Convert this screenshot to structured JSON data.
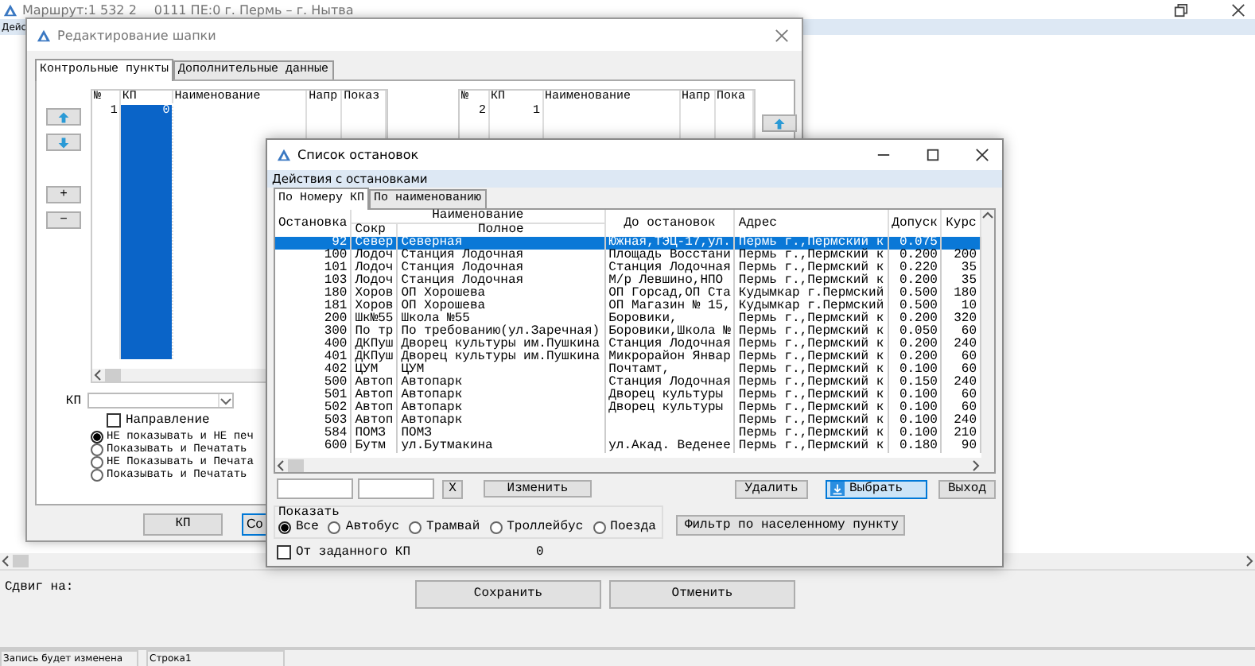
{
  "main_window": {
    "title_route": "Маршрут:1 532 2",
    "title_info": "0111 ПЕ:0 г. Пермь – г. Нытва",
    "menu_item": "Дейс",
    "shift_label": "Сдвиг на:",
    "buttons": [
      "Сохранить",
      "Отменить"
    ],
    "status_bar": [
      "Запись будет изменена",
      "Строка1"
    ]
  },
  "editor": {
    "title": "Редактирование шапки",
    "tabs": [
      {
        "label": "Контрольные пункты",
        "selected": true
      },
      {
        "label": "Дополнительные данные",
        "selected": false
      }
    ],
    "left_grid": {
      "columns": [
        "№",
        "КП",
        "Наименование",
        "Напр",
        "Показ"
      ],
      "rows": [
        {
          "cells": [
            "1",
            "0"
          ],
          "selected": true
        }
      ]
    },
    "right_grid": {
      "columns": [
        "№",
        "КП",
        "Наименование",
        "Напр",
        "Пока"
      ],
      "rows": [
        {
          "cells": [
            "2",
            "1"
          ],
          "selected": false
        }
      ]
    },
    "side_buttons": [
      "+",
      "−"
    ],
    "kp_label": "КП",
    "direction_checkbox": {
      "label": "Направление",
      "checked": false
    },
    "print_options": [
      {
        "label": "НЕ показывать и НЕ печ",
        "selected": true
      },
      {
        "label": "Показывать и Печатать",
        "selected": false
      },
      {
        "label": "НЕ Показывать и Печата",
        "selected": false
      },
      {
        "label": "Показывать и Печатать",
        "selected": false
      }
    ],
    "buttons": [
      "КП",
      "Со"
    ]
  },
  "dialog": {
    "title": "Список остановок",
    "menu_item": "Действия с остановками",
    "tabs": [
      {
        "label": "По Номеру КП",
        "selected": true
      },
      {
        "label": "По наименованию",
        "selected": false
      }
    ],
    "grid": {
      "header_group": "Наименование",
      "columns": [
        "Остановка",
        "Сокр",
        "Полное",
        "До остановок",
        "Адрес",
        "Допуск",
        "Курс"
      ],
      "rows": [
        {
          "cells": [
            "92",
            "Север",
            "Северная",
            "Южная,ТЭЦ-17,ул.",
            "Пермь г.,Пермский к",
            "0.075",
            ""
          ],
          "selected": true
        },
        {
          "cells": [
            "100",
            "Лодоч",
            "Станция Лодочная",
            "Площадь Восстани",
            "Пермь г.,Пермский к",
            "0.200",
            "200"
          ],
          "selected": false
        },
        {
          "cells": [
            "101",
            "Лодоч",
            "Станция Лодочная",
            "Станция Лодочная",
            "Пермь г.,Пермский к",
            "0.220",
            "35"
          ],
          "selected": false
        },
        {
          "cells": [
            "103",
            "Лодоч",
            "Станция Лодочная",
            "М/р Левшино,НПО",
            "Пермь г.,Пермский к",
            "0.200",
            "35"
          ],
          "selected": false
        },
        {
          "cells": [
            "180",
            "Хоров",
            "ОП Хорошева",
            "ОП Горсад,ОП Ста",
            "Кудымкар г.Пермский",
            "0.500",
            "180"
          ],
          "selected": false
        },
        {
          "cells": [
            "181",
            "Хоров",
            "ОП Хорошева",
            "ОП Магазин № 15,",
            "Кудымкар г.Пермский",
            "0.500",
            "10"
          ],
          "selected": false
        },
        {
          "cells": [
            "200",
            "Шк№55",
            "Школа №55",
            "Боровики,",
            "Пермь г.,Пермский к",
            "0.200",
            "320"
          ],
          "selected": false
        },
        {
          "cells": [
            "300",
            "По тр",
            "По требованию(ул.Заречная)",
            "Боровики,Школа №",
            "Пермь г.,Пермский к",
            "0.050",
            "60"
          ],
          "selected": false
        },
        {
          "cells": [
            "400",
            "ДКПуш",
            "Дворец культуры им.Пушкина",
            "Станция Лодочная",
            "Пермь г.,Пермский к",
            "0.200",
            "240"
          ],
          "selected": false
        },
        {
          "cells": [
            "401",
            "ДКПуш",
            "Дворец культуры им.Пушкина",
            "Микрорайон Январ",
            "Пермь г.,Пермский к",
            "0.200",
            "60"
          ],
          "selected": false
        },
        {
          "cells": [
            "402",
            "ЦУМ",
            "ЦУМ",
            "Почтамт,",
            "Пермь г.,Пермский к",
            "0.100",
            "60"
          ],
          "selected": false
        },
        {
          "cells": [
            "500",
            "Автоп",
            "Автопарк",
            "Станция Лодочная",
            "Пермь г.,Пермский к",
            "0.150",
            "240"
          ],
          "selected": false
        },
        {
          "cells": [
            "501",
            "Автоп",
            "Автопарк",
            "Дворец культуры",
            "Пермь г.,Пермский к",
            "0.100",
            "60"
          ],
          "selected": false
        },
        {
          "cells": [
            "502",
            "Автоп",
            "Автопарк",
            "Дворец культуры",
            "Пермь г.,Пермский к",
            "0.100",
            "60"
          ],
          "selected": false
        },
        {
          "cells": [
            "503",
            "Автоп",
            "Автопарк",
            "",
            "Пермь г.,Пермский к",
            "0.100",
            "240"
          ],
          "selected": false
        },
        {
          "cells": [
            "584",
            "ПОМЗ",
            "ПОМЗ",
            "",
            "Пермь г.,Пермский к",
            "0.100",
            "210"
          ],
          "selected": false
        },
        {
          "cells": [
            "600",
            "Бутм",
            "ул.Бутмакина",
            "ул.Акад. Веденее",
            "Пермь г.,Пермский к",
            "0.180",
            "90"
          ],
          "selected": false
        }
      ]
    },
    "clear_button": "X",
    "edit_button": "Изменить",
    "delete_button": "Удалить",
    "select_button": {
      "label": "Выбрать",
      "focused": true
    },
    "exit_button": "Выход",
    "show_group": {
      "title": "Показать",
      "options": [
        {
          "label": "Все",
          "selected": true
        },
        {
          "label": "Автобус",
          "selected": false
        },
        {
          "label": "Трамвай",
          "selected": false
        },
        {
          "label": "Троллейбус",
          "selected": false
        },
        {
          "label": "Поезда",
          "selected": false
        }
      ]
    },
    "filter_button": "Фильтр по населенному пункту",
    "from_kp_checkbox": {
      "label": "От заданного КП",
      "checked": false
    },
    "from_kp_value": "0"
  }
}
